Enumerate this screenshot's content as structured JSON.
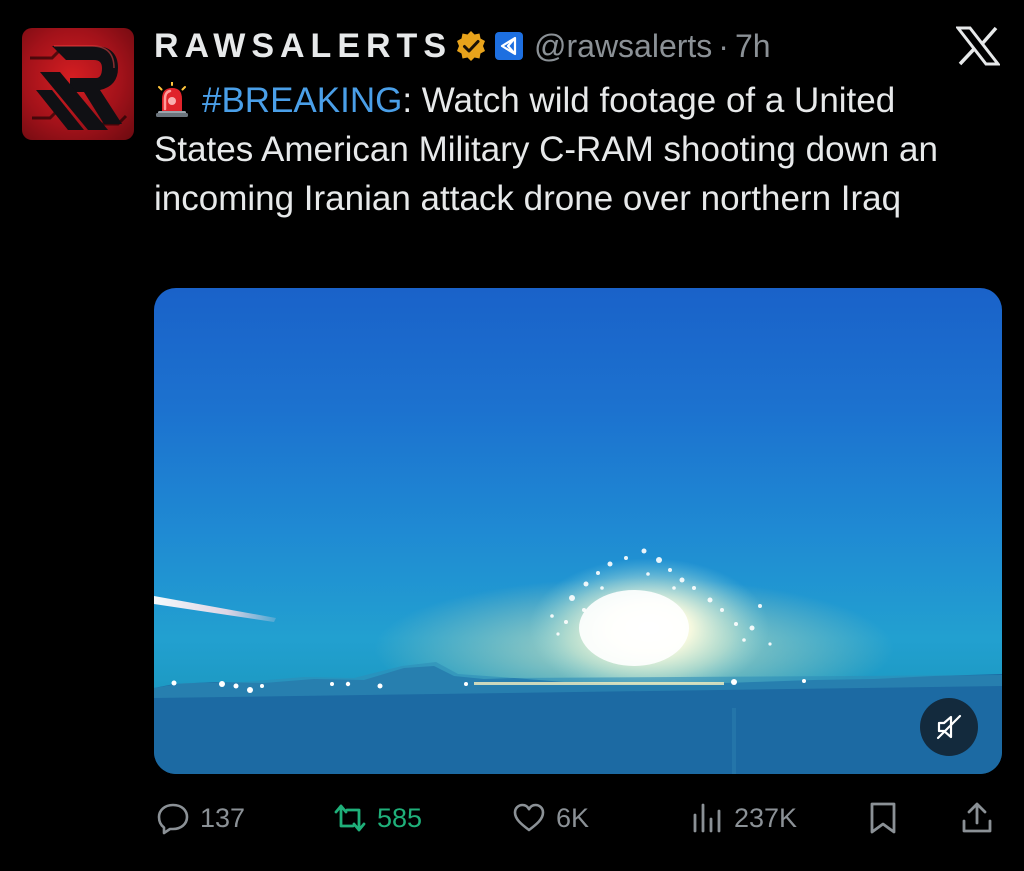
{
  "tweet": {
    "author": {
      "display_name": "RAWSALERTS",
      "handle": "@rawsalerts",
      "time": "7h",
      "separator": "·"
    },
    "icons": {
      "avatar": "raw-logo-icon",
      "verified": "verified-badge-icon",
      "affiliation": "affiliation-badge-icon",
      "platform": "x-logo-icon",
      "siren": "siren-emoji-icon"
    },
    "text": {
      "hashtag": "#BREAKING",
      "body": ": Watch wild footage of a United States American Military C-RAM shooting down an incoming Iranian attack drone over northern Iraq"
    },
    "media": {
      "type": "video",
      "mute_icon": "muted-speaker-icon"
    },
    "actions": {
      "replies": "137",
      "retweets": "585",
      "likes": "6K",
      "views": "237K"
    },
    "colors": {
      "background": "#000000",
      "text": "#e7e9ea",
      "muted": "#8b9196",
      "hashtag": "#4a9fe8",
      "retweet": "#1fb07a",
      "verified": "#e8a31b",
      "affiliation": "#1d6fe0"
    }
  }
}
